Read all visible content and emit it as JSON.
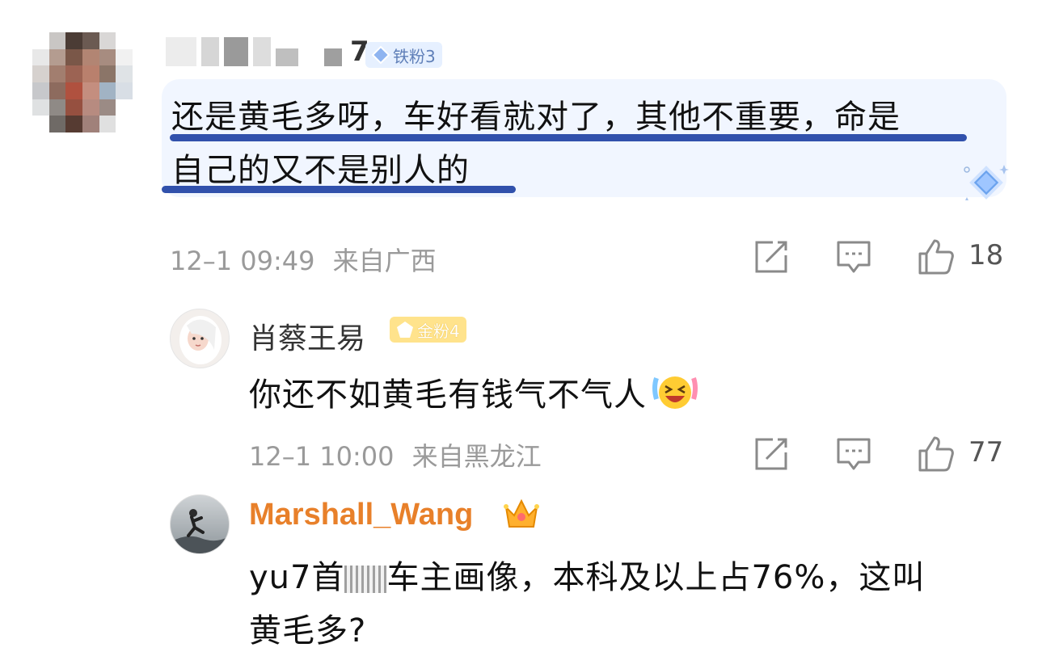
{
  "comment": {
    "user_name_visible": "7",
    "badge": "铁粉3",
    "text_line1": "还是黄毛多呀，车好看就对了，其他不重要，命是",
    "text_line2": "自己的又不是别人的",
    "time": "12–1 09:49",
    "location": "来自广西",
    "likes": "18"
  },
  "replies": [
    {
      "user_name": "肖蔡王易",
      "badge": "金粉4",
      "text": "你还不如黄毛有钱气不气人",
      "emoji": "laughing-tears-emoji",
      "time": "12–1 10:00",
      "location": "来自黑龙江",
      "likes": "77"
    },
    {
      "user_name": "Marshall_Wang",
      "crown": "crown-icon",
      "text_before_blur": "yu7首",
      "text_after_blur": "车主画像，本科及以上占76%，这叫",
      "text_line2": "黄毛多?"
    }
  ],
  "colors": {
    "bubble_bg": "#f1f6ff",
    "underline": "#1c3fa3",
    "meta": "#9a9a9a",
    "orange_name": "#e8802a",
    "iron_badge": "#5f7fb8",
    "gold_badge": "#ffe38c"
  }
}
